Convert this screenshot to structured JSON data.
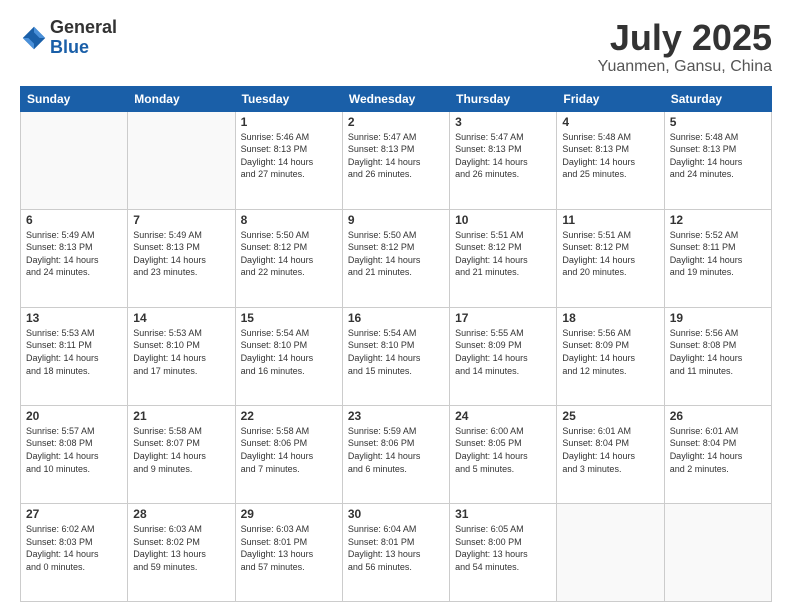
{
  "logo": {
    "general": "General",
    "blue": "Blue"
  },
  "header": {
    "month": "July 2025",
    "location": "Yuanmen, Gansu, China"
  },
  "weekdays": [
    "Sunday",
    "Monday",
    "Tuesday",
    "Wednesday",
    "Thursday",
    "Friday",
    "Saturday"
  ],
  "weeks": [
    [
      {
        "day": "",
        "content": ""
      },
      {
        "day": "",
        "content": ""
      },
      {
        "day": "1",
        "content": "Sunrise: 5:46 AM\nSunset: 8:13 PM\nDaylight: 14 hours\nand 27 minutes."
      },
      {
        "day": "2",
        "content": "Sunrise: 5:47 AM\nSunset: 8:13 PM\nDaylight: 14 hours\nand 26 minutes."
      },
      {
        "day": "3",
        "content": "Sunrise: 5:47 AM\nSunset: 8:13 PM\nDaylight: 14 hours\nand 26 minutes."
      },
      {
        "day": "4",
        "content": "Sunrise: 5:48 AM\nSunset: 8:13 PM\nDaylight: 14 hours\nand 25 minutes."
      },
      {
        "day": "5",
        "content": "Sunrise: 5:48 AM\nSunset: 8:13 PM\nDaylight: 14 hours\nand 24 minutes."
      }
    ],
    [
      {
        "day": "6",
        "content": "Sunrise: 5:49 AM\nSunset: 8:13 PM\nDaylight: 14 hours\nand 24 minutes."
      },
      {
        "day": "7",
        "content": "Sunrise: 5:49 AM\nSunset: 8:13 PM\nDaylight: 14 hours\nand 23 minutes."
      },
      {
        "day": "8",
        "content": "Sunrise: 5:50 AM\nSunset: 8:12 PM\nDaylight: 14 hours\nand 22 minutes."
      },
      {
        "day": "9",
        "content": "Sunrise: 5:50 AM\nSunset: 8:12 PM\nDaylight: 14 hours\nand 21 minutes."
      },
      {
        "day": "10",
        "content": "Sunrise: 5:51 AM\nSunset: 8:12 PM\nDaylight: 14 hours\nand 21 minutes."
      },
      {
        "day": "11",
        "content": "Sunrise: 5:51 AM\nSunset: 8:12 PM\nDaylight: 14 hours\nand 20 minutes."
      },
      {
        "day": "12",
        "content": "Sunrise: 5:52 AM\nSunset: 8:11 PM\nDaylight: 14 hours\nand 19 minutes."
      }
    ],
    [
      {
        "day": "13",
        "content": "Sunrise: 5:53 AM\nSunset: 8:11 PM\nDaylight: 14 hours\nand 18 minutes."
      },
      {
        "day": "14",
        "content": "Sunrise: 5:53 AM\nSunset: 8:10 PM\nDaylight: 14 hours\nand 17 minutes."
      },
      {
        "day": "15",
        "content": "Sunrise: 5:54 AM\nSunset: 8:10 PM\nDaylight: 14 hours\nand 16 minutes."
      },
      {
        "day": "16",
        "content": "Sunrise: 5:54 AM\nSunset: 8:10 PM\nDaylight: 14 hours\nand 15 minutes."
      },
      {
        "day": "17",
        "content": "Sunrise: 5:55 AM\nSunset: 8:09 PM\nDaylight: 14 hours\nand 14 minutes."
      },
      {
        "day": "18",
        "content": "Sunrise: 5:56 AM\nSunset: 8:09 PM\nDaylight: 14 hours\nand 12 minutes."
      },
      {
        "day": "19",
        "content": "Sunrise: 5:56 AM\nSunset: 8:08 PM\nDaylight: 14 hours\nand 11 minutes."
      }
    ],
    [
      {
        "day": "20",
        "content": "Sunrise: 5:57 AM\nSunset: 8:08 PM\nDaylight: 14 hours\nand 10 minutes."
      },
      {
        "day": "21",
        "content": "Sunrise: 5:58 AM\nSunset: 8:07 PM\nDaylight: 14 hours\nand 9 minutes."
      },
      {
        "day": "22",
        "content": "Sunrise: 5:58 AM\nSunset: 8:06 PM\nDaylight: 14 hours\nand 7 minutes."
      },
      {
        "day": "23",
        "content": "Sunrise: 5:59 AM\nSunset: 8:06 PM\nDaylight: 14 hours\nand 6 minutes."
      },
      {
        "day": "24",
        "content": "Sunrise: 6:00 AM\nSunset: 8:05 PM\nDaylight: 14 hours\nand 5 minutes."
      },
      {
        "day": "25",
        "content": "Sunrise: 6:01 AM\nSunset: 8:04 PM\nDaylight: 14 hours\nand 3 minutes."
      },
      {
        "day": "26",
        "content": "Sunrise: 6:01 AM\nSunset: 8:04 PM\nDaylight: 14 hours\nand 2 minutes."
      }
    ],
    [
      {
        "day": "27",
        "content": "Sunrise: 6:02 AM\nSunset: 8:03 PM\nDaylight: 14 hours\nand 0 minutes."
      },
      {
        "day": "28",
        "content": "Sunrise: 6:03 AM\nSunset: 8:02 PM\nDaylight: 13 hours\nand 59 minutes."
      },
      {
        "day": "29",
        "content": "Sunrise: 6:03 AM\nSunset: 8:01 PM\nDaylight: 13 hours\nand 57 minutes."
      },
      {
        "day": "30",
        "content": "Sunrise: 6:04 AM\nSunset: 8:01 PM\nDaylight: 13 hours\nand 56 minutes."
      },
      {
        "day": "31",
        "content": "Sunrise: 6:05 AM\nSunset: 8:00 PM\nDaylight: 13 hours\nand 54 minutes."
      },
      {
        "day": "",
        "content": ""
      },
      {
        "day": "",
        "content": ""
      }
    ]
  ]
}
